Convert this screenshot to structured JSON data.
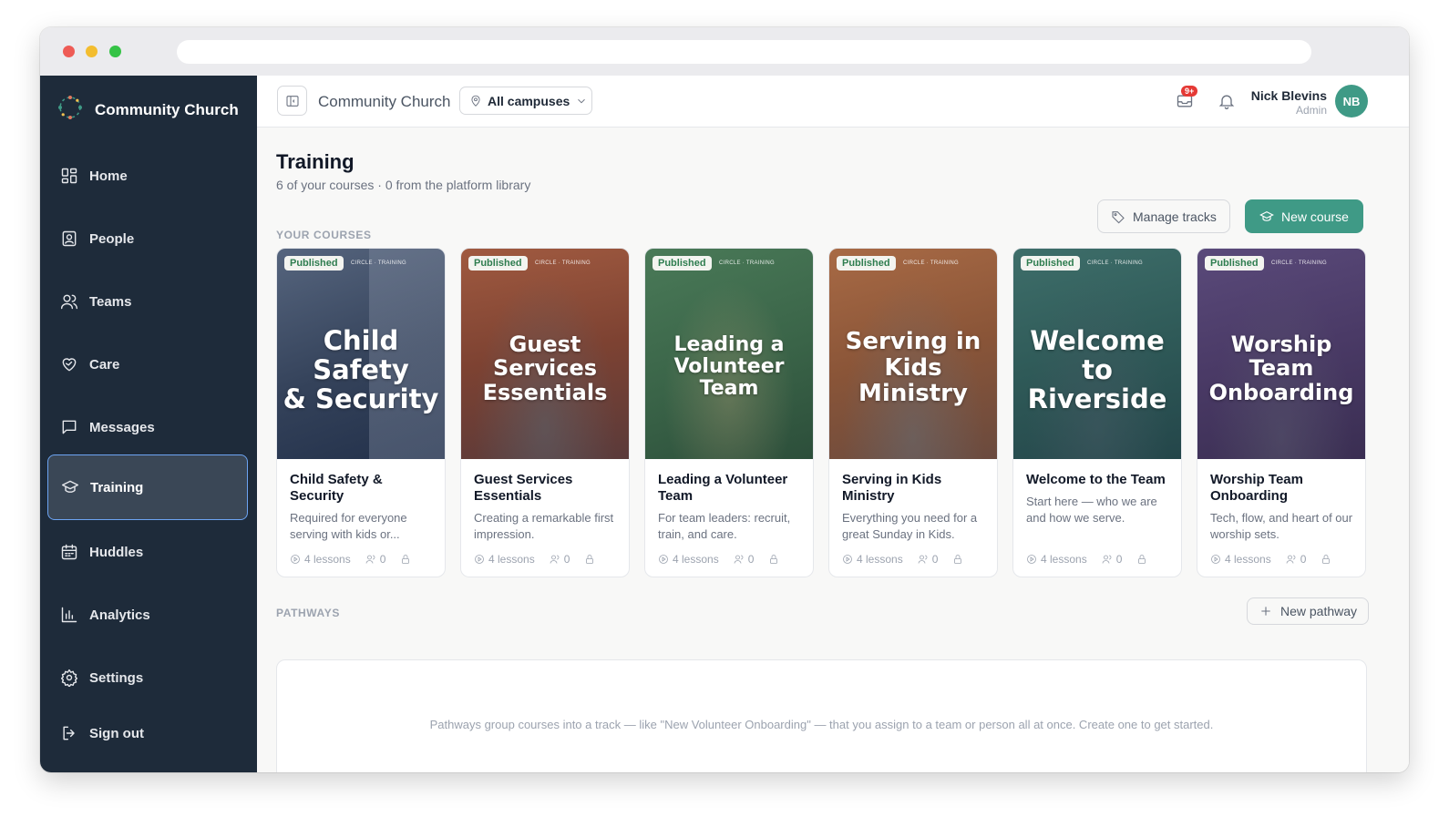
{
  "sidebar": {
    "org_name": "Community Church",
    "items": [
      {
        "label": "Home",
        "icon": "grid-icon"
      },
      {
        "label": "People",
        "icon": "contact-icon"
      },
      {
        "label": "Teams",
        "icon": "users-icon"
      },
      {
        "label": "Care",
        "icon": "heart-handshake-icon"
      },
      {
        "label": "Messages",
        "icon": "message-icon"
      },
      {
        "label": "Training",
        "icon": "graduation-cap-icon",
        "active": true
      },
      {
        "label": "Huddles",
        "icon": "calendar-icon"
      },
      {
        "label": "Analytics",
        "icon": "bar-chart-icon"
      },
      {
        "label": "Settings",
        "icon": "gear-icon"
      },
      {
        "label": "Sign out",
        "icon": "sign-out-icon"
      }
    ]
  },
  "topbar": {
    "title": "Community Church",
    "campus_select": "All campuses",
    "mail_badge": "9+",
    "user": {
      "name": "Nick Blevins",
      "role": "Admin",
      "initials": "NB"
    }
  },
  "page": {
    "title": "Training",
    "subtitle": "6 of your courses · 0 from the platform library",
    "manage_tracks": "Manage tracks",
    "new_course": "New course"
  },
  "courses_section": {
    "label": "YOUR COURSES",
    "courses": [
      {
        "status": "Published",
        "brand": "CIRCLE · TRAINING",
        "image_title": "Child Safety\n& Security",
        "title": "Child Safety & Security",
        "description": "Required for everyone serving with kids or...",
        "lessons": "4 lessons",
        "members": "0",
        "color": "#3a4a66"
      },
      {
        "status": "Published",
        "brand": "CIRCLE · TRAINING",
        "image_title": "Guest Services\nEssentials",
        "title": "Guest Services Essentials",
        "description": "Creating a remarkable first impression.",
        "lessons": "4 lessons",
        "members": "0",
        "color": "#8a4a3a"
      },
      {
        "status": "Published",
        "brand": "CIRCLE · TRAINING",
        "image_title": "Leading a\nVolunteer Team",
        "title": "Leading a Volunteer Team",
        "description": "For team leaders: recruit, train, and care.",
        "lessons": "4 lessons",
        "members": "0",
        "color": "#3f6b4e"
      },
      {
        "status": "Published",
        "brand": "CIRCLE · TRAINING",
        "image_title": "Serving in\nKids Ministry",
        "title": "Serving in Kids Ministry",
        "description": "Everything you need for a great Sunday in Kids.",
        "lessons": "4 lessons",
        "members": "0",
        "color": "#8b5a3a"
      },
      {
        "status": "Published",
        "brand": "CIRCLE · TRAINING",
        "image_title": "Welcome to\nRiverside",
        "title": "Welcome to the Team",
        "description": "Start here — who we are and how we serve.",
        "lessons": "4 lessons",
        "members": "0",
        "color": "#2f5a58"
      },
      {
        "status": "Published",
        "brand": "CIRCLE · TRAINING",
        "image_title": "Worship Team\nOnboarding",
        "title": "Worship Team Onboarding",
        "description": "Tech, flow, and heart of our worship sets.",
        "lessons": "4 lessons",
        "members": "0",
        "color": "#4a3a66"
      }
    ]
  },
  "pathways_section": {
    "label": "PATHWAYS",
    "new_pathway": "New pathway",
    "empty_text": "Pathways group courses into a track — like \"New Volunteer Onboarding\" — that you assign to a team or person all at once. Create one to get started."
  }
}
